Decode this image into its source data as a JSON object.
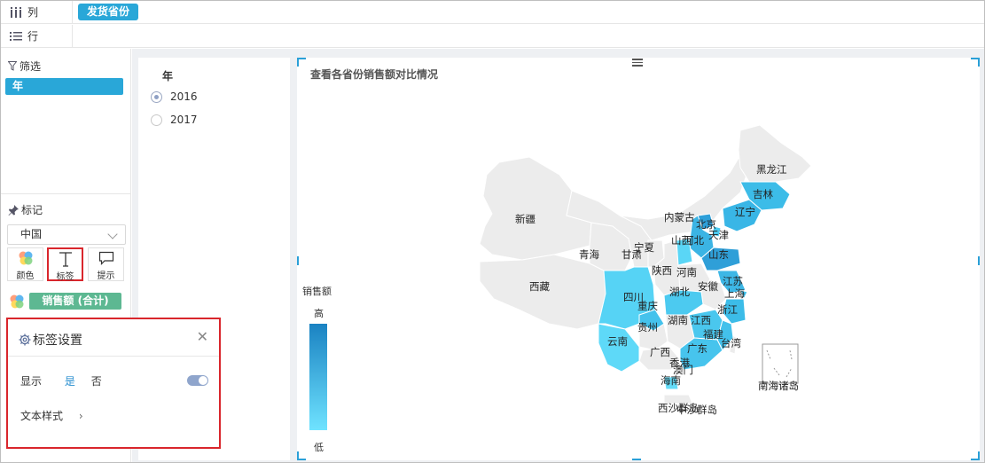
{
  "columns_shelf": {
    "icon": "columns-icon",
    "label": "列",
    "pill": "发货省份"
  },
  "rows_shelf": {
    "icon": "rows-icon",
    "label": "行"
  },
  "filter": {
    "icon": "filter-icon",
    "title": "筛选",
    "pill": "年"
  },
  "marks": {
    "icon": "pin-icon",
    "title": "标记",
    "map_select": "中国",
    "buttons": [
      {
        "icon": "color-palette-icon",
        "label": "颜色"
      },
      {
        "icon": "text-label-icon",
        "label": "标签"
      },
      {
        "icon": "tooltip-icon",
        "label": "提示"
      }
    ],
    "measure_pill": "销售额 (合计)"
  },
  "label_settings": {
    "icon": "gear-icon",
    "title": "标签设置",
    "display_label": "显示",
    "yes": "是",
    "no": "否",
    "toggle_on": true,
    "text_style": "文本样式"
  },
  "year_filter": {
    "title": "年",
    "options": [
      {
        "label": "2016",
        "selected": true
      },
      {
        "label": "2017",
        "selected": false
      }
    ]
  },
  "chart": {
    "title": "查看各省份销售额对比情况",
    "legend_title": "销售额",
    "legend_high": "高",
    "legend_low": "低",
    "colors": {
      "high": "#1a82c2",
      "low": "#6fe3ff",
      "none": "#ececec"
    },
    "provinces": [
      "黑龙江",
      "吉林",
      "辽宁",
      "内蒙古",
      "北京",
      "天津",
      "河北",
      "山西",
      "宁夏",
      "甘肃",
      "青海",
      "新疆",
      "西藏",
      "陕西",
      "河南",
      "山东",
      "江苏",
      "安徽",
      "上海",
      "湖北",
      "四川",
      "重庆",
      "浙江",
      "贵州",
      "湖南",
      "江西",
      "云南",
      "福建",
      "台湾",
      "广西",
      "广东",
      "香港",
      "澳门",
      "海南",
      "南海诸岛",
      "西沙群岛",
      "中沙群岛"
    ]
  }
}
